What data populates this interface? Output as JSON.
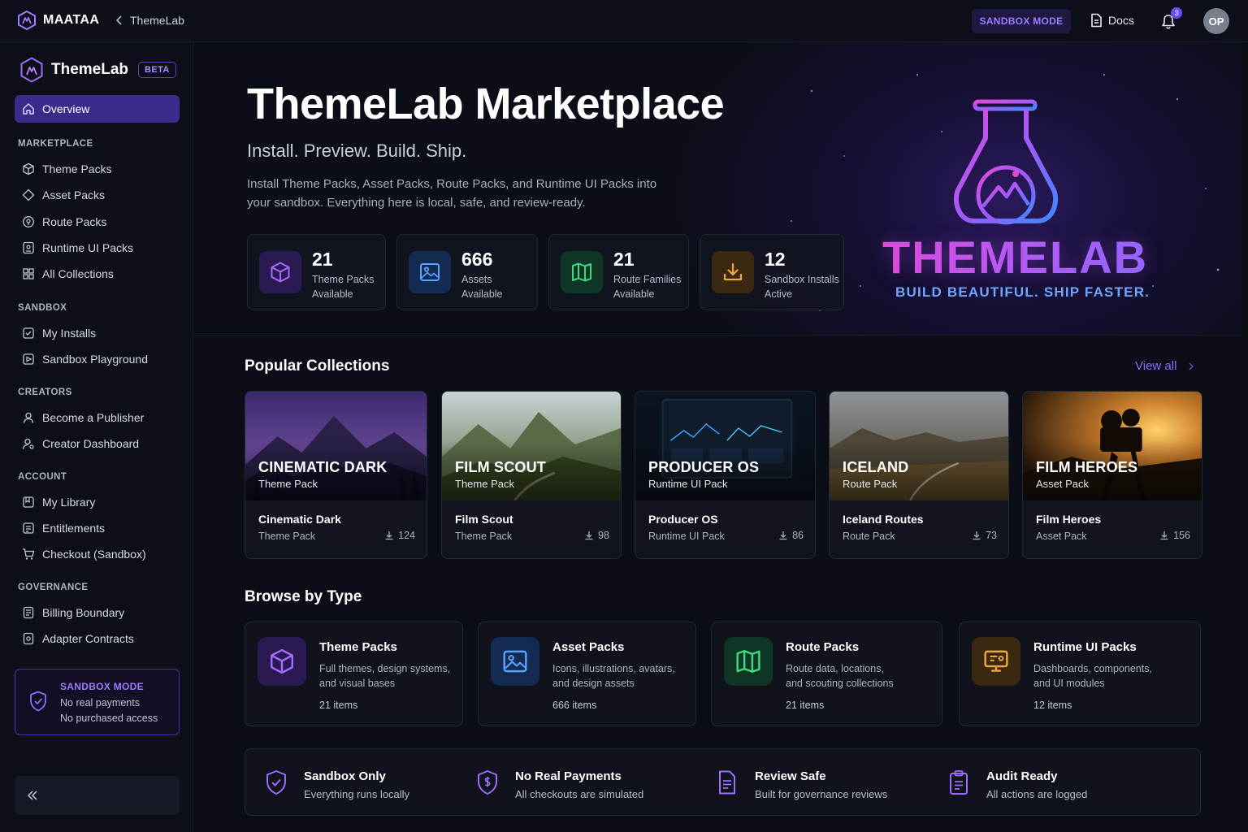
{
  "topbar": {
    "brand": "MAATAA",
    "breadcrumb": "ThemeLab",
    "sandbox_pill": "SANDBOX MODE",
    "docs": "Docs",
    "notifications_count": "3",
    "avatar_initials": "OP"
  },
  "sidebar": {
    "brand": "ThemeLab",
    "badge": "BETA",
    "overview": "Overview",
    "sections": [
      {
        "title": "MARKETPLACE",
        "items": [
          "Theme Packs",
          "Asset Packs",
          "Route Packs",
          "Runtime UI Packs",
          "All Collections"
        ]
      },
      {
        "title": "SANDBOX",
        "items": [
          "My Installs",
          "Sandbox Playground"
        ]
      },
      {
        "title": "CREATORS",
        "items": [
          "Become a Publisher",
          "Creator Dashboard"
        ]
      },
      {
        "title": "ACCOUNT",
        "items": [
          "My Library",
          "Entitlements",
          "Checkout (Sandbox)"
        ]
      },
      {
        "title": "GOVERNANCE",
        "items": [
          "Billing Boundary",
          "Adapter Contracts"
        ]
      }
    ],
    "sandbox_box": {
      "title": "SANDBOX MODE",
      "line1": "No real payments",
      "line2": "No purchased access"
    }
  },
  "hero": {
    "title": "ThemeLab Marketplace",
    "subtitle": "Install. Preview. Build. Ship.",
    "description": "Install Theme Packs, Asset Packs, Route Packs, and Runtime UI Packs into your sandbox. Everything here is local, safe, and review-ready.",
    "logo_word": "THEMELAB",
    "tagline": "BUILD BEAUTIFUL. SHIP FASTER.",
    "stats": [
      {
        "value": "21",
        "label1": "Theme Packs",
        "label2": "Available",
        "color": "#a86bff"
      },
      {
        "value": "666",
        "label1": "Assets",
        "label2": "Available",
        "color": "#5aa0ff"
      },
      {
        "value": "21",
        "label1": "Route Families",
        "label2": "Available",
        "color": "#3fd97f"
      },
      {
        "value": "12",
        "label1": "Sandbox Installs",
        "label2": "Active",
        "color": "#f0a83a"
      }
    ]
  },
  "popular": {
    "title": "Popular Collections",
    "view_all": "View all",
    "cards": [
      {
        "overlay_title": "CINEMATIC DARK",
        "overlay_sub": "Theme Pack",
        "name": "Cinematic Dark",
        "type": "Theme Pack",
        "downloads": "124"
      },
      {
        "overlay_title": "FILM SCOUT",
        "overlay_sub": "Theme Pack",
        "name": "Film Scout",
        "type": "Theme Pack",
        "downloads": "98"
      },
      {
        "overlay_title": "PRODUCER OS",
        "overlay_sub": "Runtime UI Pack",
        "name": "Producer OS",
        "type": "Runtime UI Pack",
        "downloads": "86"
      },
      {
        "overlay_title": "ICELAND",
        "overlay_sub": "Route Pack",
        "name": "Iceland Routes",
        "type": "Route Pack",
        "downloads": "73"
      },
      {
        "overlay_title": "FILM HEROES",
        "overlay_sub": "Asset Pack",
        "name": "Film Heroes",
        "type": "Asset Pack",
        "downloads": "156"
      }
    ]
  },
  "browse": {
    "title": "Browse by Type",
    "types": [
      {
        "title": "Theme Packs",
        "desc1": "Full themes, design systems,",
        "desc2": "and visual bases",
        "count": "21 items"
      },
      {
        "title": "Asset Packs",
        "desc1": "Icons, illustrations, avatars,",
        "desc2": "and design assets",
        "count": "666 items"
      },
      {
        "title": "Route Packs",
        "desc1": "Route data, locations,",
        "desc2": "and scouting collections",
        "count": "21 items"
      },
      {
        "title": "Runtime UI Packs",
        "desc1": "Dashboards, components,",
        "desc2": "and UI modules",
        "count": "12 items"
      }
    ]
  },
  "features": [
    {
      "title": "Sandbox Only",
      "desc": "Everything runs locally"
    },
    {
      "title": "No Real Payments",
      "desc": "All checkouts are simulated"
    },
    {
      "title": "Review Safe",
      "desc": "Built for governance reviews"
    },
    {
      "title": "Audit Ready",
      "desc": "All actions are logged"
    }
  ]
}
